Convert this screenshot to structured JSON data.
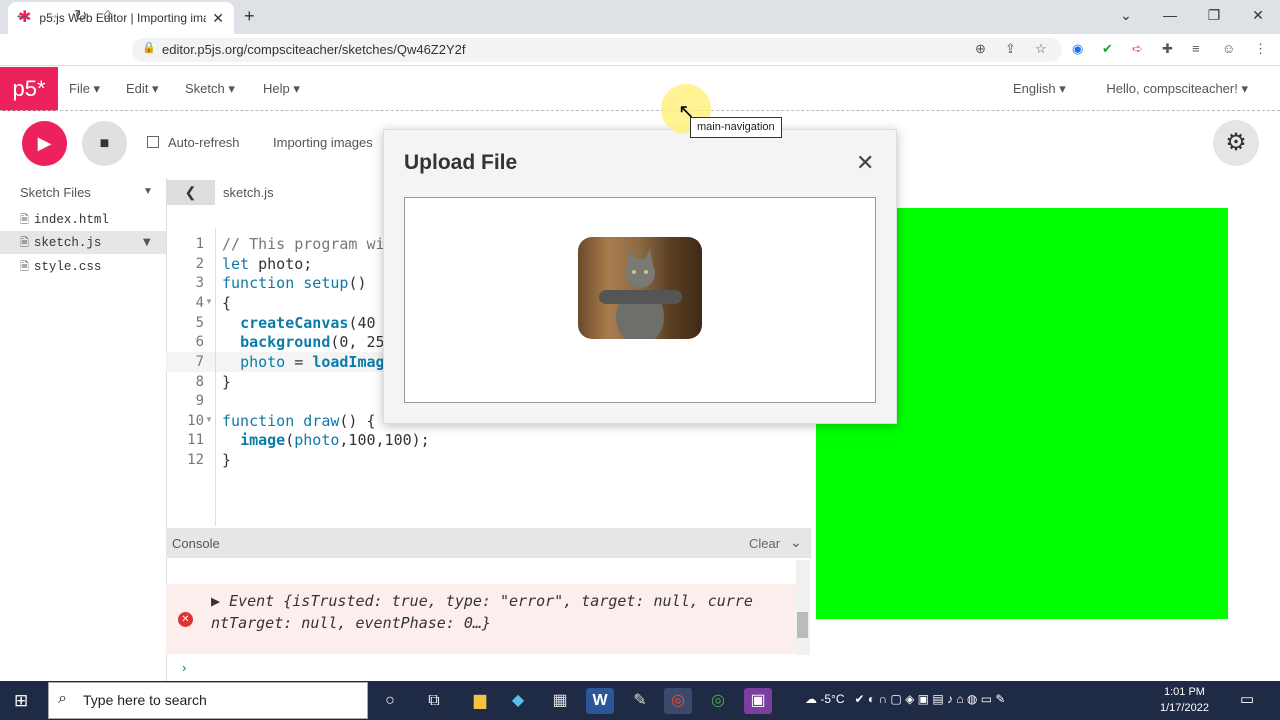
{
  "browser": {
    "tab_title": "p5.js Web Editor | Importing ima",
    "tab_close": "✕",
    "new_tab": "+",
    "url": "editor.p5js.org/compsciteacher/sketches/Qw46Z2Y2f",
    "window_controls": [
      "⌄",
      "—",
      "❐",
      "✕"
    ]
  },
  "header": {
    "logo": "p5*",
    "menus": [
      "File ▾",
      "Edit ▾",
      "Sketch ▾",
      "Help ▾"
    ],
    "language": "English ▾",
    "greeting": "Hello, compsciteacher! ▾"
  },
  "toolbar": {
    "play": "▶",
    "stop": "■",
    "auto_refresh_label": "Auto-refresh",
    "project_name": "Importing images"
  },
  "sidebar": {
    "title": "Sketch Files",
    "files": [
      "index.html",
      "sketch.js",
      "style.css"
    ]
  },
  "editor": {
    "tab_name": "sketch.js",
    "line_numbers": [
      "1",
      "2",
      "3",
      "4",
      "5",
      "6",
      "7",
      "8",
      "9",
      "10",
      "11",
      "12"
    ]
  },
  "console": {
    "title": "Console",
    "clear": "Clear",
    "error_line1": "Event {isTrusted: true, type: \"error\", target: null, curre",
    "error_line2": "ntTarget: null, eventPhase: 0…}",
    "prompt": "›"
  },
  "modal": {
    "title": "Upload File",
    "close": "✕"
  },
  "tooltip": "main-navigation",
  "taskbar": {
    "search_placeholder": "Type here to search",
    "weather": "-5°C",
    "time": "1:01 PM",
    "date": "1/17/2022"
  },
  "colors": {
    "p5_pink": "#ed225d",
    "preview_green": "#00ff00"
  }
}
